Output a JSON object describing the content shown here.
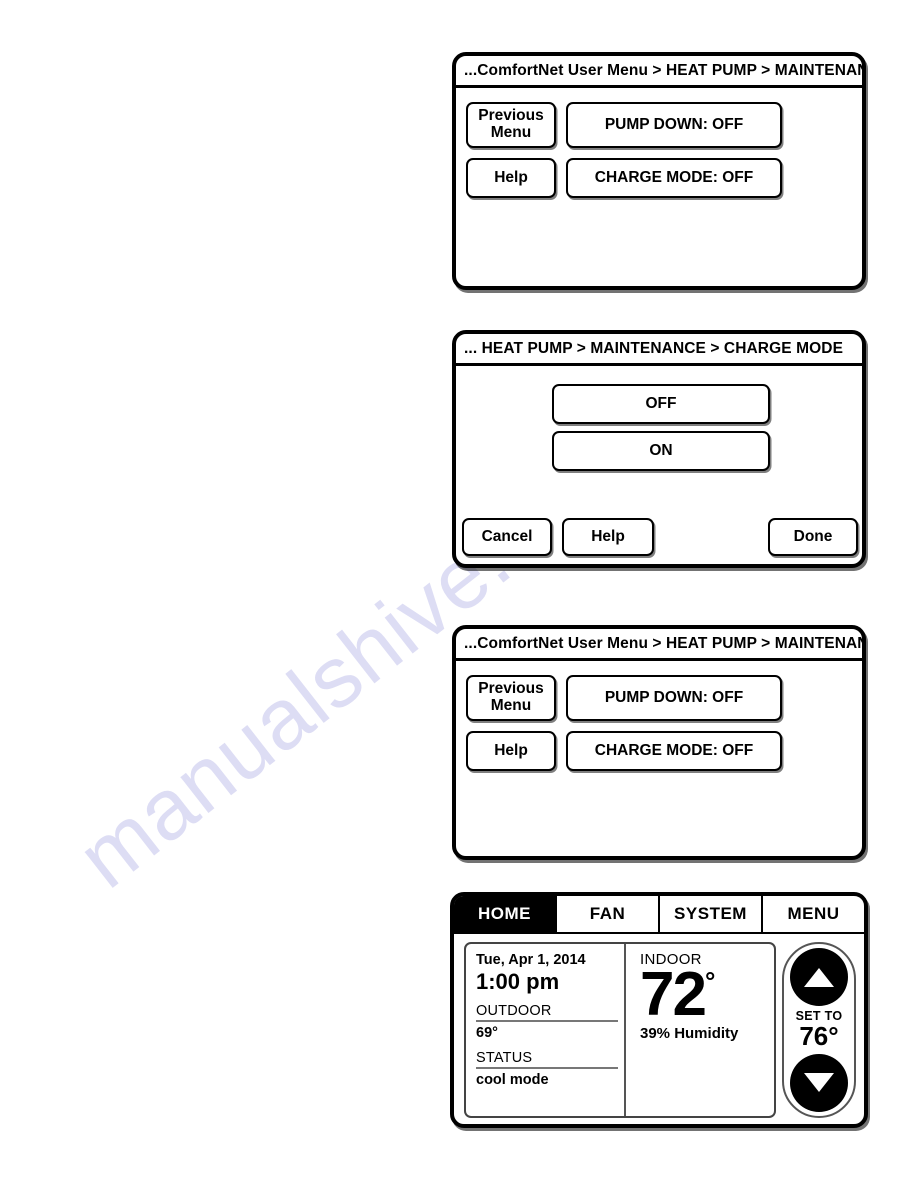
{
  "panels": [
    {
      "id": "maintenance-top",
      "breadcrumb": "...ComfortNet User Menu > HEAT PUMP  >  MAINTENANCE",
      "previous_menu_line1": "Previous",
      "previous_menu_line2": "Menu",
      "help_label": "Help",
      "pump_down_label": "PUMP DOWN:  OFF",
      "charge_mode_label": "CHARGE MODE:  OFF"
    },
    {
      "id": "charge-mode",
      "breadcrumb": "...  HEAT PUMP > MAINTENANCE  >  CHARGE MODE",
      "option_off": "OFF",
      "option_on": "ON",
      "cancel_label": "Cancel",
      "help_label": "Help",
      "done_label": "Done"
    },
    {
      "id": "maintenance-bottom",
      "breadcrumb": "...ComfortNet User Menu > HEAT PUMP  >  MAINTENANCE",
      "previous_menu_line1": "Previous",
      "previous_menu_line2": "Menu",
      "help_label": "Help",
      "pump_down_label": "PUMP DOWN:  OFF",
      "charge_mode_label": "CHARGE MODE:  OFF"
    }
  ],
  "home_screen": {
    "tabs": [
      {
        "label": "HOME",
        "active": true
      },
      {
        "label": "FAN",
        "active": false
      },
      {
        "label": "SYSTEM",
        "active": false
      },
      {
        "label": "MENU",
        "active": false
      }
    ],
    "date": "Tue, Apr 1, 2014",
    "time": "1:00 pm",
    "outdoor_label": "OUTDOOR",
    "outdoor_value": "69°",
    "status_label": "STATUS",
    "status_value": "cool mode",
    "indoor_label": "INDOOR",
    "indoor_temp": "72",
    "indoor_degree": "°",
    "humidity": "39% Humidity",
    "set_to_label": "SET TO",
    "set_to_value": "76°",
    "up_arrow": "up-arrow-icon",
    "down_arrow": "down-arrow-icon"
  },
  "watermark": {
    "text": "manualshive.com"
  },
  "colors": {
    "ink": "#000000",
    "paper": "#ffffff",
    "watermark": "#c9c9ee"
  }
}
